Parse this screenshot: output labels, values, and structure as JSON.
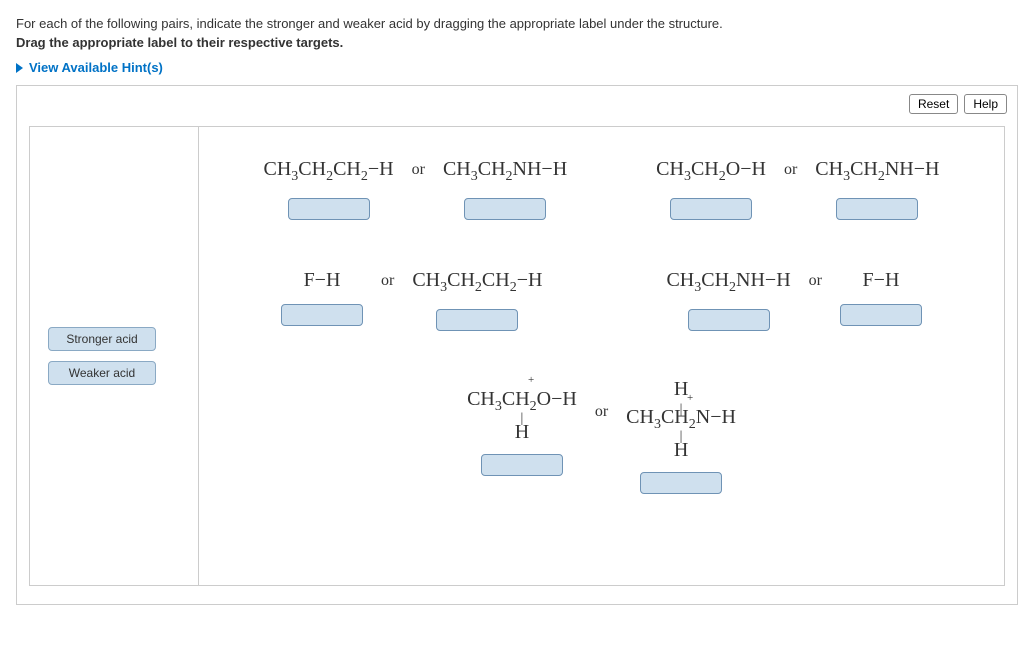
{
  "instructions": {
    "line1": "For each of the following pairs, indicate the stronger and weaker acid by dragging the appropriate label under the structure.",
    "line2": "Drag the appropriate label to their respective targets."
  },
  "hints_label": "View Available Hint(s)",
  "buttons": {
    "reset": "Reset",
    "help": "Help"
  },
  "labels": {
    "stronger": "Stronger acid",
    "weaker": "Weaker acid"
  },
  "or_text": "or",
  "pairs": {
    "p1a": "CH<sub>3</sub>CH<sub>2</sub>CH<sub>2</sub>−H",
    "p1b": "CH<sub>3</sub>CH<sub>2</sub>NH−H",
    "p2a": "CH<sub>3</sub>CH<sub>2</sub>O−H",
    "p2b": "CH<sub>3</sub>CH<sub>2</sub>NH−H",
    "p3a": "F−H",
    "p3b": "CH<sub>3</sub>CH<sub>2</sub>CH<sub>2</sub>−H",
    "p4a": "CH<sub>3</sub>CH<sub>2</sub>NH−H",
    "p4b": "F−H",
    "p5a_main": "CH<sub>3</sub>CH<sub>2</sub>O−H",
    "p5b_main": "CH<sub>3</sub>CH<sub>2</sub>N−H",
    "plus": "+",
    "H": "H",
    "vbond": "|"
  }
}
